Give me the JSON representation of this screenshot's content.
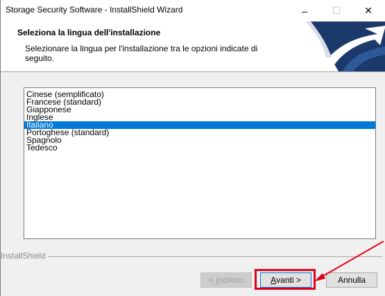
{
  "window": {
    "title": "Storage Security Software - InstallShield Wizard",
    "minimize_glyph": "–",
    "maximize_glyph": "☐",
    "close_glyph": "✕"
  },
  "header": {
    "title": "Seleziona la lingua dell'installazione",
    "description": "Selezionare la lingua per l'installazione tra le opzioni indicate di seguito."
  },
  "languages": {
    "items": [
      "Cinese (semplificato)",
      "Francese (standard)",
      "Giapponese",
      "Inglese",
      "Italiano",
      "Portoghese (standard)",
      "Spagnolo",
      "Tedesco"
    ],
    "selected": "Italiano"
  },
  "footer": {
    "brand": "InstallShield"
  },
  "buttons": {
    "back_prefix": "< ",
    "back_accel": "I",
    "back_rest": "ndietro",
    "next_accel": "A",
    "next_rest": "vanti >",
    "cancel": "Annulla"
  },
  "colors": {
    "selection": "#0078d7",
    "highlight": "#e2001a"
  },
  "icons": {
    "logo": "installshield-logo-icon",
    "annotation": "arrow-icon"
  }
}
